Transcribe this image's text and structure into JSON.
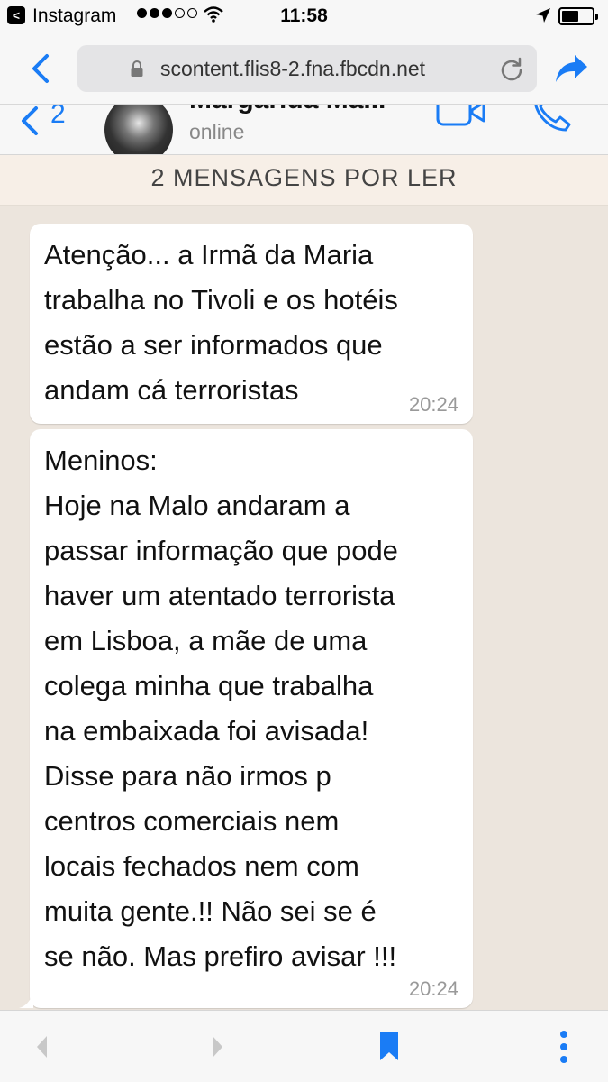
{
  "status_bar": {
    "app_name": "Instagram",
    "back_glyph": "<",
    "time": "11:58"
  },
  "browser": {
    "url": "scontent.flis8-2.fna.fbcdn.net"
  },
  "chat_header": {
    "back_count": "2",
    "contact_name": "Margarida Ma...",
    "contact_status": "online"
  },
  "unread_banner": "2 MENSAGENS POR LER",
  "messages": [
    {
      "text": "Atenção... a Irmã da Maria\ntrabalha no Tivoli e os hotéis\nestão a ser informados que\nandam cá terroristas",
      "time": "20:24"
    },
    {
      "text": "Meninos:\nHoje na Malo andaram a\npassar informação que pode\nhaver um atentado terrorista\nem Lisboa, a mãe de uma\ncolega minha que trabalha\nna embaixada foi avisada!\nDisse para não irmos p\ncentros comerciais nem\nlocais fechados nem com\nmuita gente.!! Não sei se é\nse não. Mas prefiro avisar !!!",
      "time": "20:24"
    }
  ],
  "icons": {
    "status": [
      "back-to-app-icon",
      "signal-icon",
      "wifi-icon",
      "location-icon",
      "battery-icon"
    ],
    "browser": [
      "back-arrow-icon",
      "lock-icon",
      "reload-icon",
      "share-icon"
    ],
    "chat_header": [
      "back-chevron-icon",
      "video-call-icon",
      "phone-call-icon"
    ],
    "bottom_bar": [
      "back-icon",
      "forward-icon",
      "bookmark-icon",
      "more-icon"
    ]
  },
  "colors": {
    "accent": "#1a7cf5",
    "chat_background": "#ece5dd",
    "bubble": "#ffffff",
    "banner": "#f7efe7"
  }
}
